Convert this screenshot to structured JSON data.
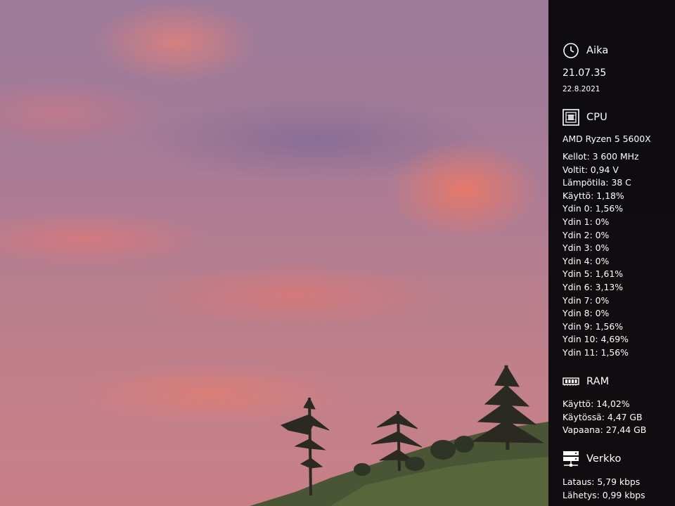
{
  "clock": {
    "title": "Aika",
    "icon": "clock-icon",
    "time": "21.07.35",
    "date": "22.8.2021"
  },
  "cpu": {
    "title": "CPU",
    "icon": "cpu-chip-icon",
    "model": "AMD Ryzen 5 5600X",
    "stats": [
      "Kellot: 3 600 MHz",
      "Voltit: 0,94 V",
      "Lämpötila: 38 C",
      "Käyttö: 1,18%",
      "Ydin 0: 1,56%",
      "Ydin 1: 0%",
      "Ydin 2: 0%",
      "Ydin 3: 0%",
      "Ydin 4: 0%",
      "Ydin 5: 1,61%",
      "Ydin 6: 3,13%",
      "Ydin 7: 0%",
      "Ydin 8: 0%",
      "Ydin 9: 1,56%",
      "Ydin 10: 4,69%",
      "Ydin 11: 1,56%"
    ]
  },
  "ram": {
    "title": "RAM",
    "icon": "memory-module-icon",
    "stats": [
      "Käyttö: 14,02%",
      "Käytössä: 4,47 GB",
      "Vapaana: 27,44 GB"
    ]
  },
  "network": {
    "title": "Verkko",
    "icon": "network-icon",
    "stats": [
      "Lataus: 5,79 kbps",
      "Lähetys: 0,99 kbps"
    ]
  },
  "colors": {
    "panel_bg": "#050508",
    "text": "#ffffff"
  }
}
